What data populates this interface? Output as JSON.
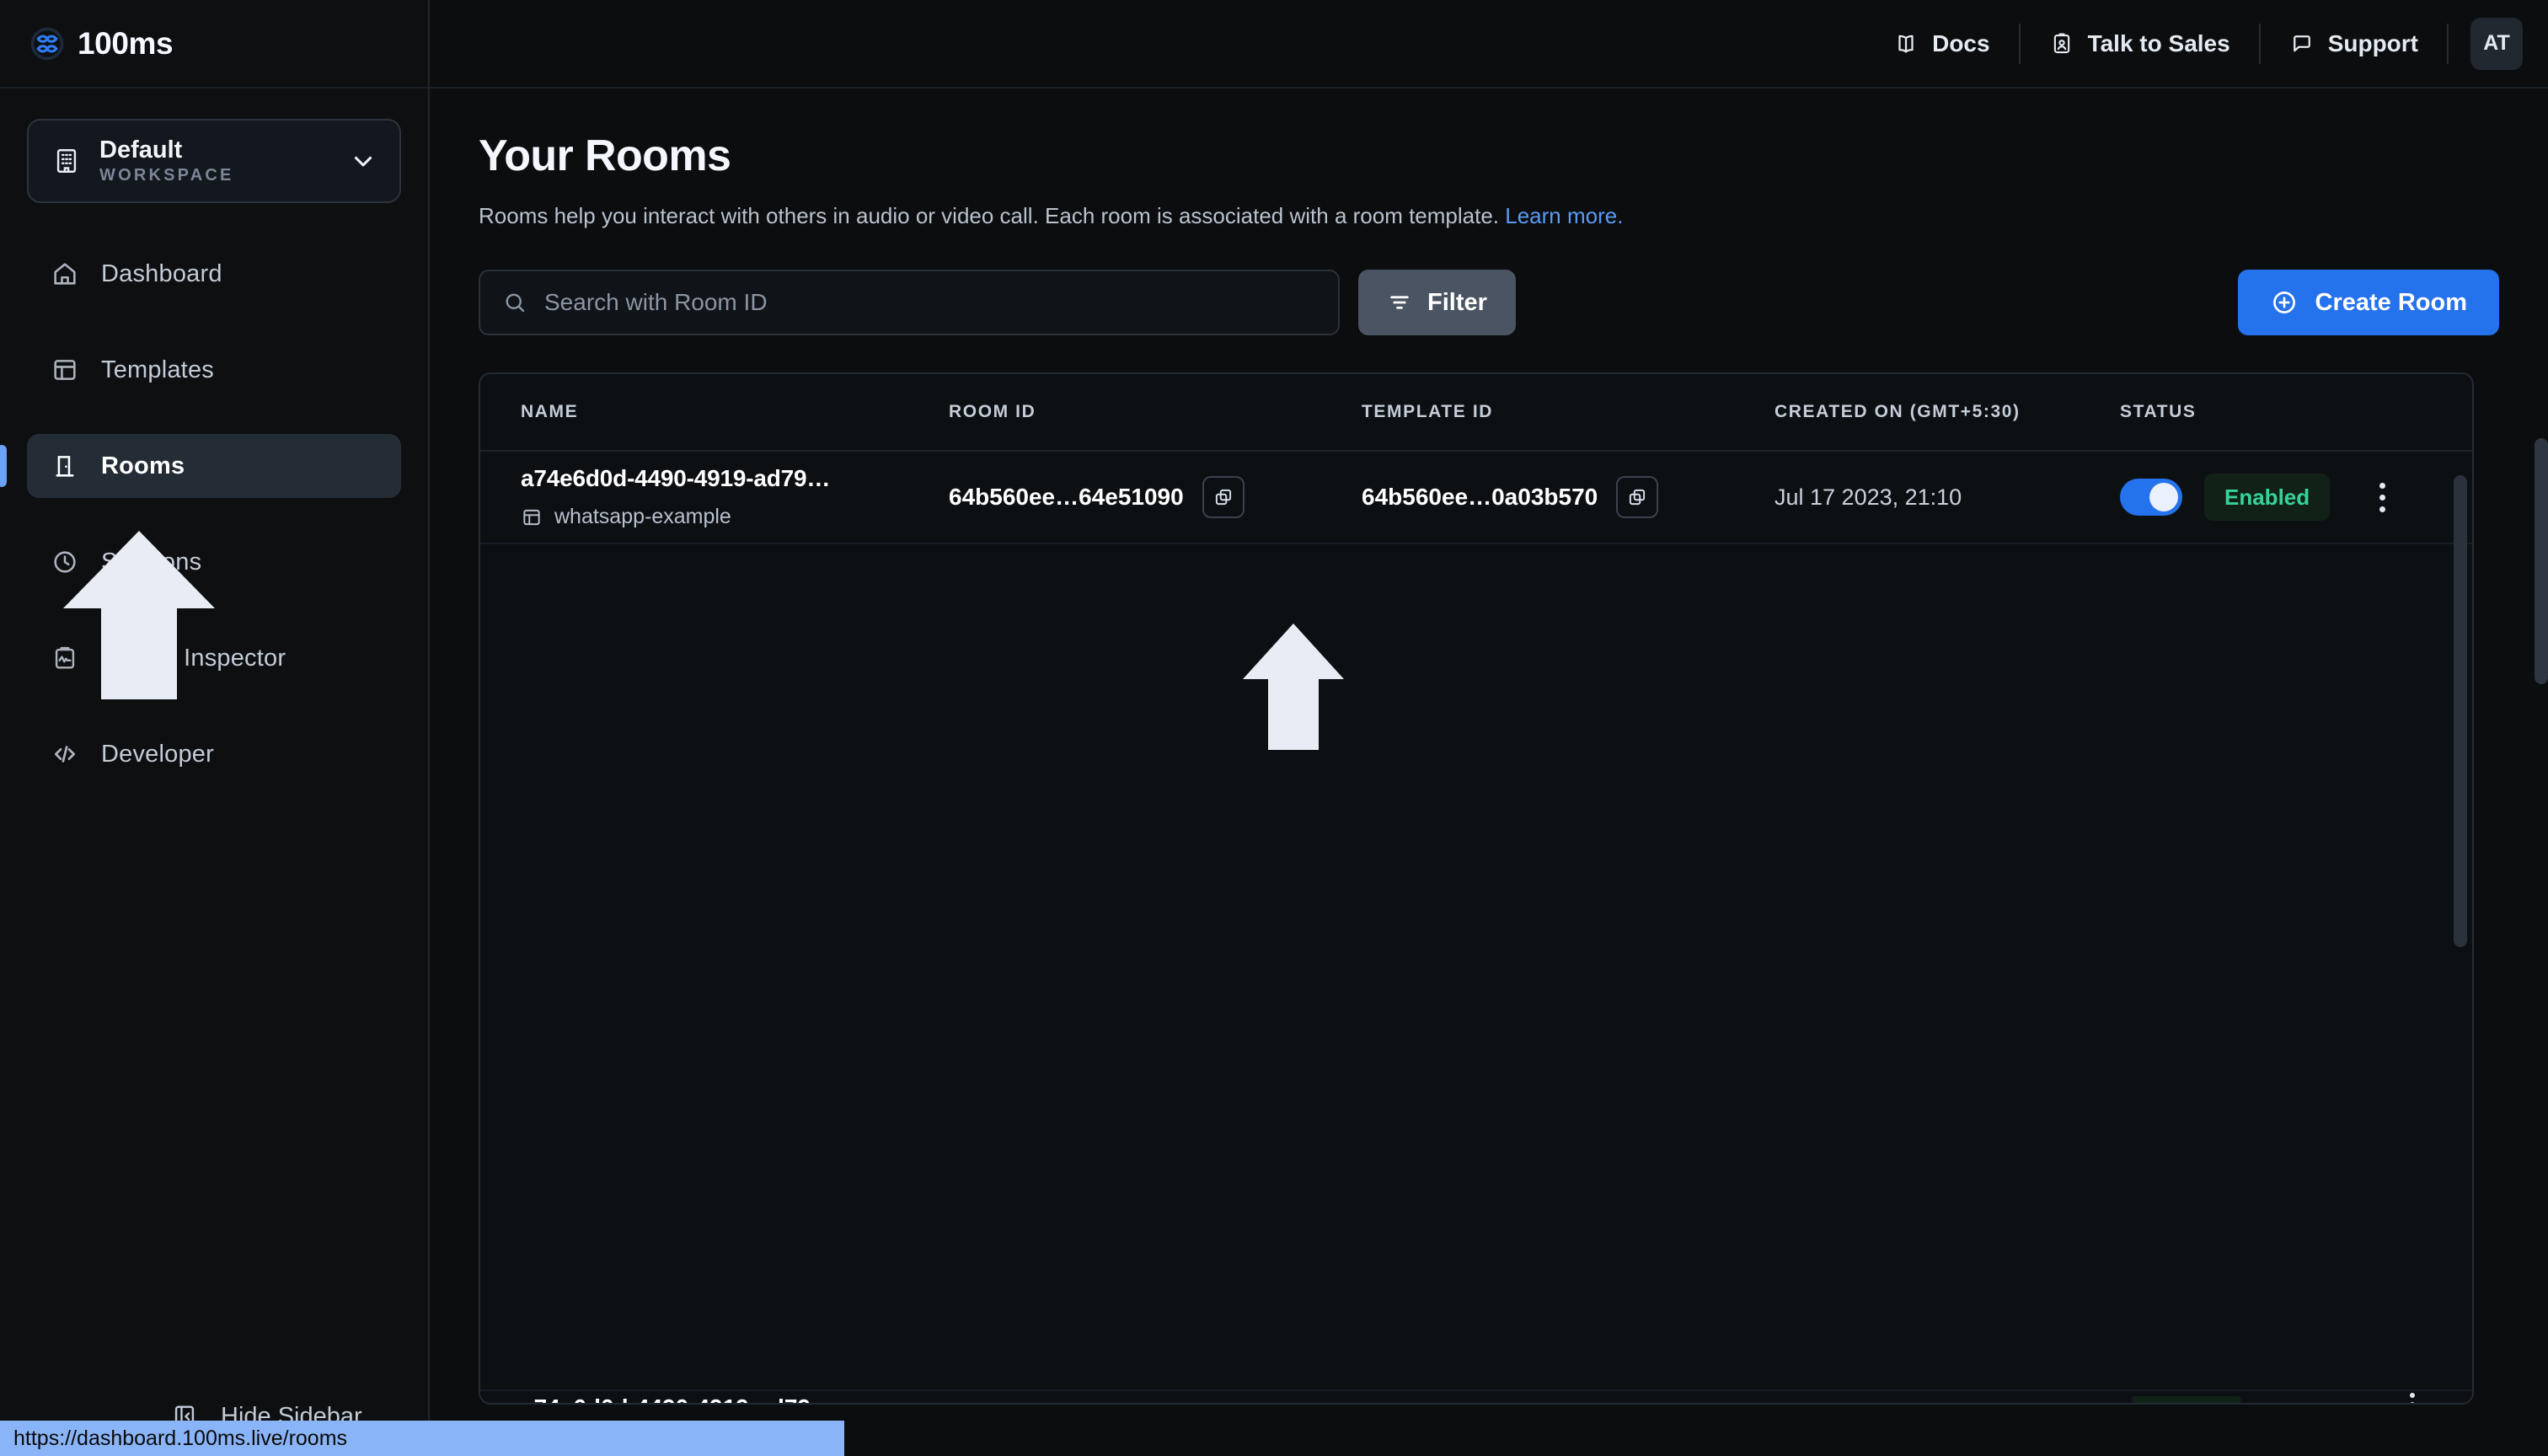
{
  "brand": {
    "name": "100ms",
    "logo_icon": "infinity-flower-logo"
  },
  "topbar": {
    "links": [
      {
        "label": "Docs",
        "icon": "book-icon"
      },
      {
        "label": "Talk to Sales",
        "icon": "contact-card-icon"
      },
      {
        "label": "Support",
        "icon": "chat-bubble-icon"
      }
    ],
    "avatar_initials": "AT"
  },
  "sidebar": {
    "workspace": {
      "title": "Default",
      "subtitle": "WORKSPACE",
      "icon": "building-icon",
      "chevron": "chevron-down-icon"
    },
    "items": [
      {
        "label": "Dashboard",
        "icon": "home-icon",
        "active": false
      },
      {
        "label": "Templates",
        "icon": "layout-icon",
        "active": false
      },
      {
        "label": "Rooms",
        "icon": "door-icon",
        "active": true
      },
      {
        "label": "Sessions",
        "icon": "clock-icon",
        "active": false
      },
      {
        "label": "Events Inspector",
        "icon": "clipboard-pulse-icon",
        "active": false
      },
      {
        "label": "Developer",
        "icon": "code-brackets-icon",
        "active": false
      }
    ],
    "hide_sidebar": {
      "label": "Hide Sidebar",
      "icon": "collapse-sidebar-icon"
    }
  },
  "page": {
    "title": "Your Rooms",
    "description": "Rooms help you interact with others in audio or video call. Each room is associated with a room template.",
    "learn_more": "Learn more."
  },
  "toolbar": {
    "search_placeholder": "Search with Room ID",
    "search_value": "",
    "search_icon": "search-icon",
    "filter_label": "Filter",
    "filter_icon": "filter-icon",
    "create_label": "Create Room",
    "create_icon": "plus-circle-icon"
  },
  "table": {
    "columns": [
      "NAME",
      "ROOM ID",
      "TEMPLATE ID",
      "CREATED ON (GMT+5:30)",
      "STATUS"
    ],
    "rows": [
      {
        "name": "a74e6d0d-4490-4919-ad79…",
        "template_name": "whatsapp-example",
        "template_name_icon": "layout-icon",
        "room_id": "64b560ee…64e51090",
        "room_id_copy_icon": "copy-icon",
        "template_id": "64b560ee…0a03b570",
        "template_id_copy_icon": "copy-icon",
        "created_on": "Jul 17 2023, 21:10",
        "toggle_on": true,
        "status_label": "Enabled",
        "menu_icon": "kebab-menu-icon"
      }
    ]
  },
  "status_bar": {
    "url": "https://dashboard.100ms.live/rooms"
  },
  "colors": {
    "accent_blue": "#2572ED",
    "link_blue": "#5A9BF6",
    "status_green": "#36D399",
    "bg": "#0B0D0F",
    "sidebar_bg": "#0D0F11",
    "active_item_bg": "#242C36",
    "filter_bg": "#4A5462"
  }
}
